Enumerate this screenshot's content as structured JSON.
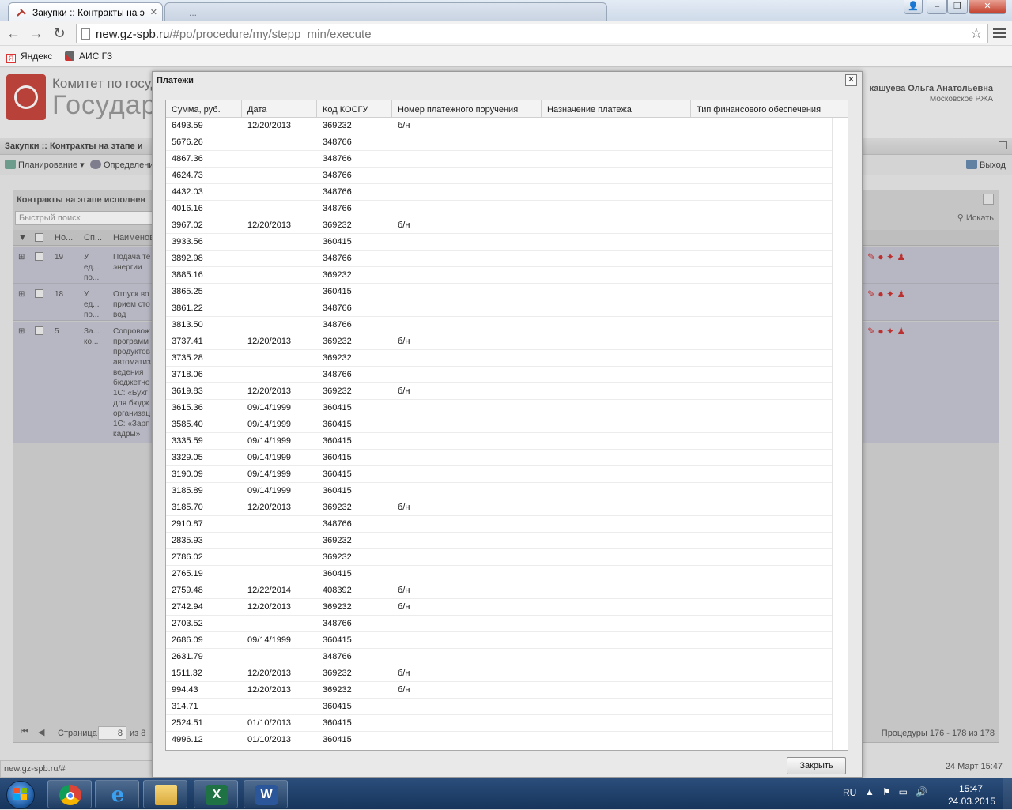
{
  "browser": {
    "active_tab_title": "Закупки :: Контракты на э",
    "inactive_tab_title": "...",
    "url_host": "new.gz-spb.ru",
    "url_path": "/#po/procedure/my/stepp_min/execute",
    "bookmarks": [
      "Яндекс",
      "АИС ГЗ"
    ],
    "status_url": "new.gz-spb.ru/#"
  },
  "app": {
    "org_line1": "Комитет по государ",
    "org_line2": "Государ",
    "user_name": "кашуева Ольга Анатольевна",
    "user_dept": "Московское РЖА",
    "breadcrumb": "Закупки :: Контракты на этапе и",
    "toolbar": {
      "planning": "Планирование",
      "defining": "Определени",
      "exit": "Выход"
    },
    "panel_title": "Контракты на этапе исполнен",
    "quick_search_placeholder": "Быстрый поиск",
    "search_label": "Искать",
    "grid_headers": [
      "Но...",
      "Сп...",
      "Наименов"
    ],
    "rows": [
      {
        "num": "19",
        "sp": "У\nед...\nпо...",
        "name": "Подача те\nэнергии"
      },
      {
        "num": "18",
        "sp": "У\nед...\nпо...",
        "name": "Отпуск во\nприем сто\nвод"
      },
      {
        "num": "5",
        "sp": "За...\nко...",
        "name": "Сопровож\nпрограмм\nпродуктов\nавтоматиз\nведения\nбюджетно\n1С: «Бухг\nдля бюдж\nорганизац\n1С: «Зарп\nкадры»"
      }
    ],
    "pager": {
      "page_label": "Страница",
      "page": "8",
      "of": "из 8",
      "summary": "Процедуры 176 - 178 из 178"
    },
    "footer_date": "24 Март 15:47"
  },
  "modal": {
    "title": "Платежи",
    "close_label": "Закрыть",
    "columns": [
      "Сумма, руб.",
      "Дата",
      "Код КОСГУ",
      "Номер платежного поручения",
      "Назначение платежа",
      "Тип финансового обеспечения"
    ],
    "rows": [
      [
        "6493.59",
        "12/20/2013",
        "369232",
        "б/н"
      ],
      [
        "5676.26",
        "",
        "348766",
        ""
      ],
      [
        "4867.36",
        "",
        "348766",
        ""
      ],
      [
        "4624.73",
        "",
        "348766",
        ""
      ],
      [
        "4432.03",
        "",
        "348766",
        ""
      ],
      [
        "4016.16",
        "",
        "348766",
        ""
      ],
      [
        "3967.02",
        "12/20/2013",
        "369232",
        "б/н"
      ],
      [
        "3933.56",
        "",
        "360415",
        ""
      ],
      [
        "3892.98",
        "",
        "348766",
        ""
      ],
      [
        "3885.16",
        "",
        "369232",
        ""
      ],
      [
        "3865.25",
        "",
        "360415",
        ""
      ],
      [
        "3861.22",
        "",
        "348766",
        ""
      ],
      [
        "3813.50",
        "",
        "348766",
        ""
      ],
      [
        "3737.41",
        "12/20/2013",
        "369232",
        "б/н"
      ],
      [
        "3735.28",
        "",
        "369232",
        ""
      ],
      [
        "3718.06",
        "",
        "348766",
        ""
      ],
      [
        "3619.83",
        "12/20/2013",
        "369232",
        "б/н"
      ],
      [
        "3615.36",
        "09/14/1999",
        "360415",
        ""
      ],
      [
        "3585.40",
        "09/14/1999",
        "360415",
        ""
      ],
      [
        "3335.59",
        "09/14/1999",
        "360415",
        ""
      ],
      [
        "3329.05",
        "09/14/1999",
        "360415",
        ""
      ],
      [
        "3190.09",
        "09/14/1999",
        "360415",
        ""
      ],
      [
        "3185.89",
        "09/14/1999",
        "360415",
        ""
      ],
      [
        "3185.70",
        "12/20/2013",
        "369232",
        "б/н"
      ],
      [
        "2910.87",
        "",
        "348766",
        ""
      ],
      [
        "2835.93",
        "",
        "369232",
        ""
      ],
      [
        "2786.02",
        "",
        "369232",
        ""
      ],
      [
        "2765.19",
        "",
        "360415",
        ""
      ],
      [
        "2759.48",
        "12/22/2014",
        "408392",
        "б/н"
      ],
      [
        "2742.94",
        "12/20/2013",
        "369232",
        "б/н"
      ],
      [
        "2703.52",
        "",
        "348766",
        ""
      ],
      [
        "2686.09",
        "09/14/1999",
        "360415",
        ""
      ],
      [
        "2631.79",
        "",
        "348766",
        ""
      ],
      [
        "1511.32",
        "12/20/2013",
        "369232",
        "б/н"
      ],
      [
        "994.43",
        "12/20/2013",
        "369232",
        "б/н"
      ],
      [
        "314.71",
        "",
        "360415",
        ""
      ],
      [
        "2524.51",
        "01/10/2013",
        "360415",
        ""
      ],
      [
        "4996.12",
        "01/10/2013",
        "360415",
        ""
      ]
    ]
  },
  "taskbar": {
    "lang": "RU",
    "time": "15:47",
    "date": "24.03.2015",
    "apps": [
      "chrome-icon",
      "ie-icon",
      "explorer-icon",
      "excel-icon",
      "word-icon"
    ]
  },
  "colors": {
    "taskbar": "#1f416c",
    "modal_bg": "#e9e9e9",
    "logo": "#c8483f"
  }
}
